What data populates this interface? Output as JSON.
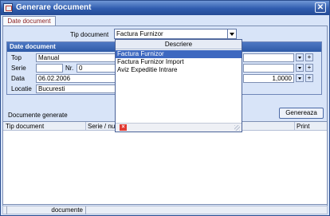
{
  "window": {
    "title": "Generare document",
    "close_glyph": "✕"
  },
  "tab": {
    "label": "Date document"
  },
  "tip_document": {
    "label": "Tip document",
    "value": "Factura Furnizor"
  },
  "groupbox": {
    "title": "Date document",
    "fields": {
      "top_label": "Top",
      "top_value": "Manual",
      "serie_label": "Serie",
      "nr_label": "Nr.",
      "nr_value": "0",
      "data_label": "Data",
      "data_value": "06.02.2006",
      "rate_value": "1,0000",
      "locatie_label": "Locatie",
      "locatie_value": "Bucuresti"
    }
  },
  "documente": {
    "label": "Documente generate"
  },
  "genereaza_button": {
    "label": "Genereaza"
  },
  "grid": {
    "columns": [
      "Tip document",
      "Serie / nu",
      "Print"
    ]
  },
  "status": {
    "text": "documente"
  },
  "dropdown": {
    "header": "Descriere",
    "options": [
      "Factura Furnizor",
      "Factura Furnizor Import",
      "Aviz Expeditie Intrare"
    ],
    "selected": "Factura Furnizor"
  }
}
